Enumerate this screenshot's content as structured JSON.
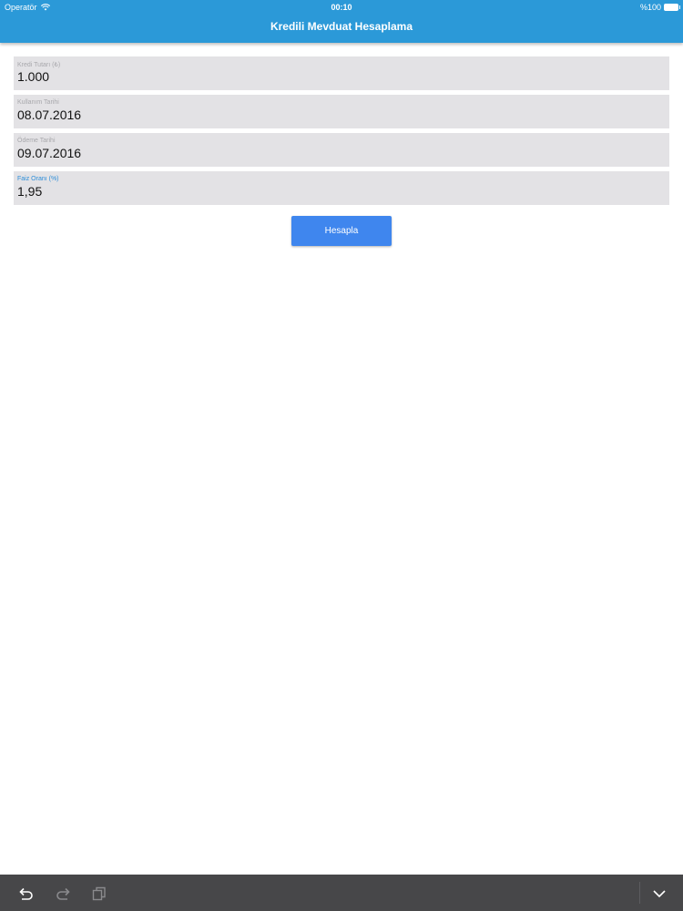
{
  "status_bar": {
    "carrier": "Operatör",
    "time": "00:10",
    "battery": "%100"
  },
  "nav": {
    "title": "Kredili Mevduat Hesaplama"
  },
  "form": {
    "fields": [
      {
        "label": "Kredi Tutarı (₺)",
        "value": "1.000"
      },
      {
        "label": "Kullanım Tarihi",
        "value": "08.07.2016"
      },
      {
        "label": "Ödeme Tarihi",
        "value": "09.07.2016"
      },
      {
        "label": "Faiz Oranı (%)",
        "value": "1,95"
      }
    ],
    "submit_label": "Hesapla"
  },
  "toolbar": {
    "icons": [
      "undo-icon",
      "redo-icon",
      "copy-icon",
      "chevron-down-icon"
    ]
  },
  "colors": {
    "header": "#2b99d8",
    "button": "#3f86ee",
    "field_bg": "#e3e2e5",
    "active_label": "#2e8ed9",
    "toolbar": "#474749"
  }
}
